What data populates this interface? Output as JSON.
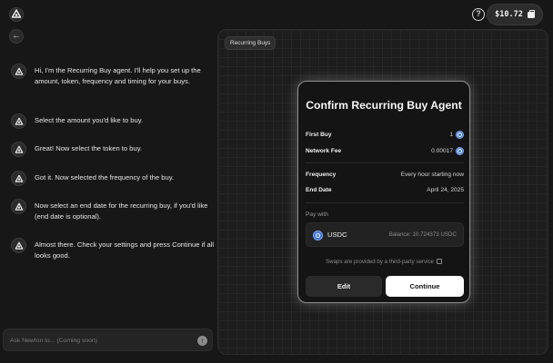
{
  "header": {
    "wallet_balance": "$10.72",
    "help_label": "?"
  },
  "chat": {
    "messages": [
      {
        "text": "Hi, I'm the Recurring Buy agent. I'll help you set up the amount, token, frequency and timing for your buys."
      },
      {
        "text": "Select the amount you'd like to buy."
      },
      {
        "text": "Great! Now select the token to buy."
      },
      {
        "text": "Got it. Now selected the frequency of the buy."
      },
      {
        "text": "Now select an end date for the recurring buy, if you'd like (end date is optional)."
      },
      {
        "text": "Almost there. Check your settings and press Continue if all looks good."
      }
    ],
    "input_placeholder": "Ask Newton to... (Coming soon)"
  },
  "canvas": {
    "tag": "Recurring Buys"
  },
  "modal": {
    "title": "Confirm Recurring Buy Agent",
    "first_buy_label": "First Buy",
    "first_buy_value": "1",
    "network_fee_label": "Network Fee",
    "network_fee_value": "0.00017",
    "frequency_label": "Frequency",
    "frequency_value": "Every hour starting now",
    "end_date_label": "End Date",
    "end_date_value": "April 24, 2025",
    "pay_with_label": "Pay with",
    "token_name": "USDC",
    "balance_text": "Balance: 10.724373 USDC",
    "swap_note": "Swaps are provided by a third-party service",
    "edit_label": "Edit",
    "continue_label": "Continue"
  },
  "colors": {
    "background": "#171717",
    "canvas": "#1d1d1d",
    "accent_coin": "#3d74d8",
    "primary_button": "#ffffff"
  },
  "icons": [
    "agent-logo-icon",
    "help-icon",
    "wallet-icon",
    "back-arrow-icon",
    "send-icon",
    "usdc-coin-icon",
    "external-link-icon"
  ]
}
